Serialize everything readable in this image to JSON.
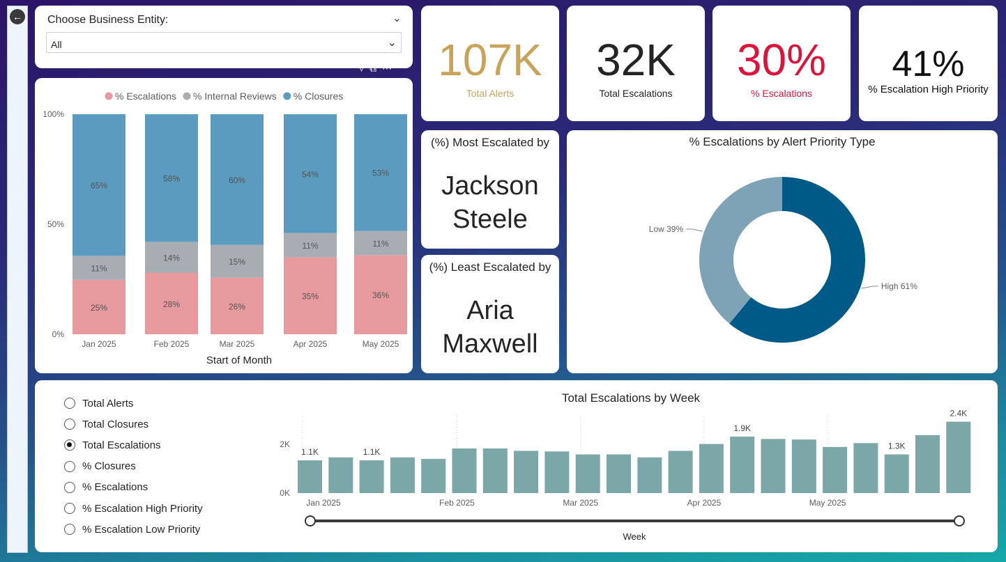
{
  "nav": {
    "back_icon": "back-arrow-icon"
  },
  "slicer": {
    "title": "Choose Business Entity:",
    "value": "All"
  },
  "kpis": [
    {
      "value": "107K",
      "label": "Total Alerts",
      "color": "#c8a45a"
    },
    {
      "value": "32K",
      "label": "Total Escalations",
      "color": "#252423"
    },
    {
      "value": "30%",
      "label": "% Escalations",
      "color": "#dc143c"
    },
    {
      "value": "41%",
      "label": "% Escalation High Priority",
      "color": "#111111"
    }
  ],
  "most_escalated": {
    "title": "(%) Most Escalated by",
    "first": "Jackson",
    "last": "Steele"
  },
  "least_escalated": {
    "title": "(%) Least Escalated by",
    "first": "Aria",
    "last": "Maxwell"
  },
  "radio_options": {
    "selected": "Total Escalations",
    "items": [
      "Total Alerts",
      "Total Closures",
      "Total Escalations",
      "% Closures",
      "% Escalations",
      "% Escalation High Priority",
      "% Escalation Low Priority"
    ]
  },
  "chart_data": [
    {
      "type": "bar",
      "stacked": "100%",
      "categories": [
        "Jan 2025",
        "Feb 2025",
        "Mar 2025",
        "Apr 2025",
        "May 2025"
      ],
      "series": [
        {
          "name": "% Escalations",
          "values": [
            25,
            28,
            26,
            35,
            36
          ],
          "labels": [
            "25%",
            "28%",
            "26%",
            "35%",
            "36%"
          ],
          "color": "#e69a9d"
        },
        {
          "name": "% Internal Reviews",
          "values": [
            11,
            14,
            15,
            11,
            11
          ],
          "labels": [
            "11%",
            "14%",
            "15%",
            "11%",
            "11%"
          ],
          "color": "#a8adb3"
        },
        {
          "name": "% Closures",
          "values": [
            65,
            58,
            60,
            54,
            53
          ],
          "labels": [
            "65%",
            "58%",
            "60%",
            "54%",
            "53%"
          ],
          "color": "#5b9bbf"
        }
      ],
      "xlabel": "Start of Month",
      "yticks": [
        "100%",
        "50%",
        "0%"
      ],
      "legend": "top"
    },
    {
      "type": "pie",
      "donut": true,
      "title": "% Escalations by Alert Priority Type",
      "slices": [
        {
          "name": "High",
          "value": 61,
          "label": "High 61%",
          "color": "#005a87"
        },
        {
          "name": "Low",
          "value": 39,
          "label": "Low 39%",
          "color": "#7fa3b6"
        }
      ]
    },
    {
      "type": "bar",
      "title": "Total Escalations by Week",
      "xlabel": "Week",
      "values": [
        1.1,
        1.2,
        1.1,
        1.2,
        1.15,
        1.5,
        1.5,
        1.42,
        1.4,
        1.3,
        1.3,
        1.2,
        1.42,
        1.65,
        1.9,
        1.82,
        1.8,
        1.55,
        1.68,
        1.3,
        1.95,
        2.4
      ],
      "value_labels": [
        "1.1K",
        "",
        "1.1K",
        "",
        "",
        "",
        "",
        "",
        "",
        "",
        "",
        "",
        "",
        "",
        "1.9K",
        "",
        "",
        "",
        "",
        "1.3K",
        "",
        "2.4K"
      ],
      "month_ticks": [
        "Jan 2025",
        "Feb 2025",
        "Mar 2025",
        "Apr 2025",
        "May 2025"
      ],
      "month_tick_bars": [
        0,
        5,
        9,
        13,
        17
      ],
      "yticks": [
        "2K",
        "0K"
      ],
      "ylim": [
        0,
        2.6
      ],
      "color": "#7ba7a8"
    }
  ]
}
